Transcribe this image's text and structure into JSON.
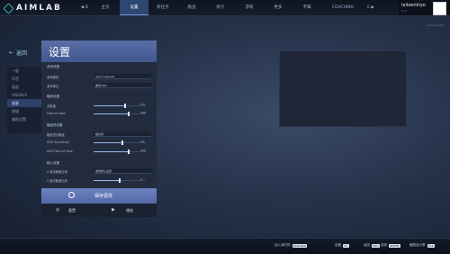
{
  "app": {
    "logo_text": "AIMLAB",
    "version_text": "v1.5.0.0.1234"
  },
  "nav": {
    "prev_symbol": "◀ Q",
    "items": [
      "主页",
      "设置",
      "新任务",
      "挑战",
      "统计",
      "游戏",
      "更多",
      "专辑",
      "COACHING"
    ],
    "active_index": 1,
    "next_symbol": "E ▶"
  },
  "user": {
    "name": "lailoenkiyo",
    "sub": "Lv 1"
  },
  "back": {
    "label": "返回"
  },
  "sidebar": {
    "items": [
      "一般",
      "声音",
      "画面",
      "VISUALS",
      "准星",
      "按键",
      "辅助设置"
    ],
    "active_index": 4
  },
  "panel": {
    "title": "设置",
    "sections": [
      {
        "title": "游戏设置"
      },
      {
        "title": "瞄准设置"
      },
      {
        "title": "瞄准镜设置"
      },
      {
        "title": "输入设置"
      }
    ],
    "rows": [
      {
        "label": "游戏模拟",
        "type": "dropdown",
        "value": "Apex Legends"
      },
      {
        "label": "游戏单位",
        "type": "dropdown",
        "value": "厘米/360"
      },
      {
        "label": "灵敏度",
        "type": "slider",
        "value": "1.5",
        "fill": 0.6
      },
      {
        "label": "Field of View",
        "type": "slider",
        "value": "104",
        "fill": 0.68
      },
      {
        "label": "瞄准镜灵敏度",
        "type": "dropdown",
        "value": "相关值"
      },
      {
        "label": "ADS Sensitivity",
        "type": "slider",
        "value": "1.1",
        "fill": 0.55
      },
      {
        "label": "ADS Field of View",
        "type": "slider",
        "value": "104",
        "fill": 0.68
      },
      {
        "label": "X 轴灵敏度比例",
        "type": "dropdown",
        "value": "使用默认设置"
      },
      {
        "label": "Y 轴灵敏度比例",
        "type": "slider",
        "value": "1",
        "fill": 0.5
      }
    ]
  },
  "buttons": {
    "save": "保存更改",
    "reset": "重置",
    "play": "播放"
  },
  "bottom": {
    "items": [
      {
        "label": "加入我们的",
        "key": "DISCORD"
      },
      {
        "label": "设置",
        "key": "F1"
      },
      {
        "label": "返回",
        "key": "ESC"
      },
      {
        "label": "选择",
        "key": "ENTER"
      },
      {
        "label": "截图及分享",
        "key": "F12"
      }
    ]
  },
  "colors": {
    "accent": "#3fd0c6",
    "nav_active": "#2e4672",
    "save_button": "#5f74b4"
  }
}
